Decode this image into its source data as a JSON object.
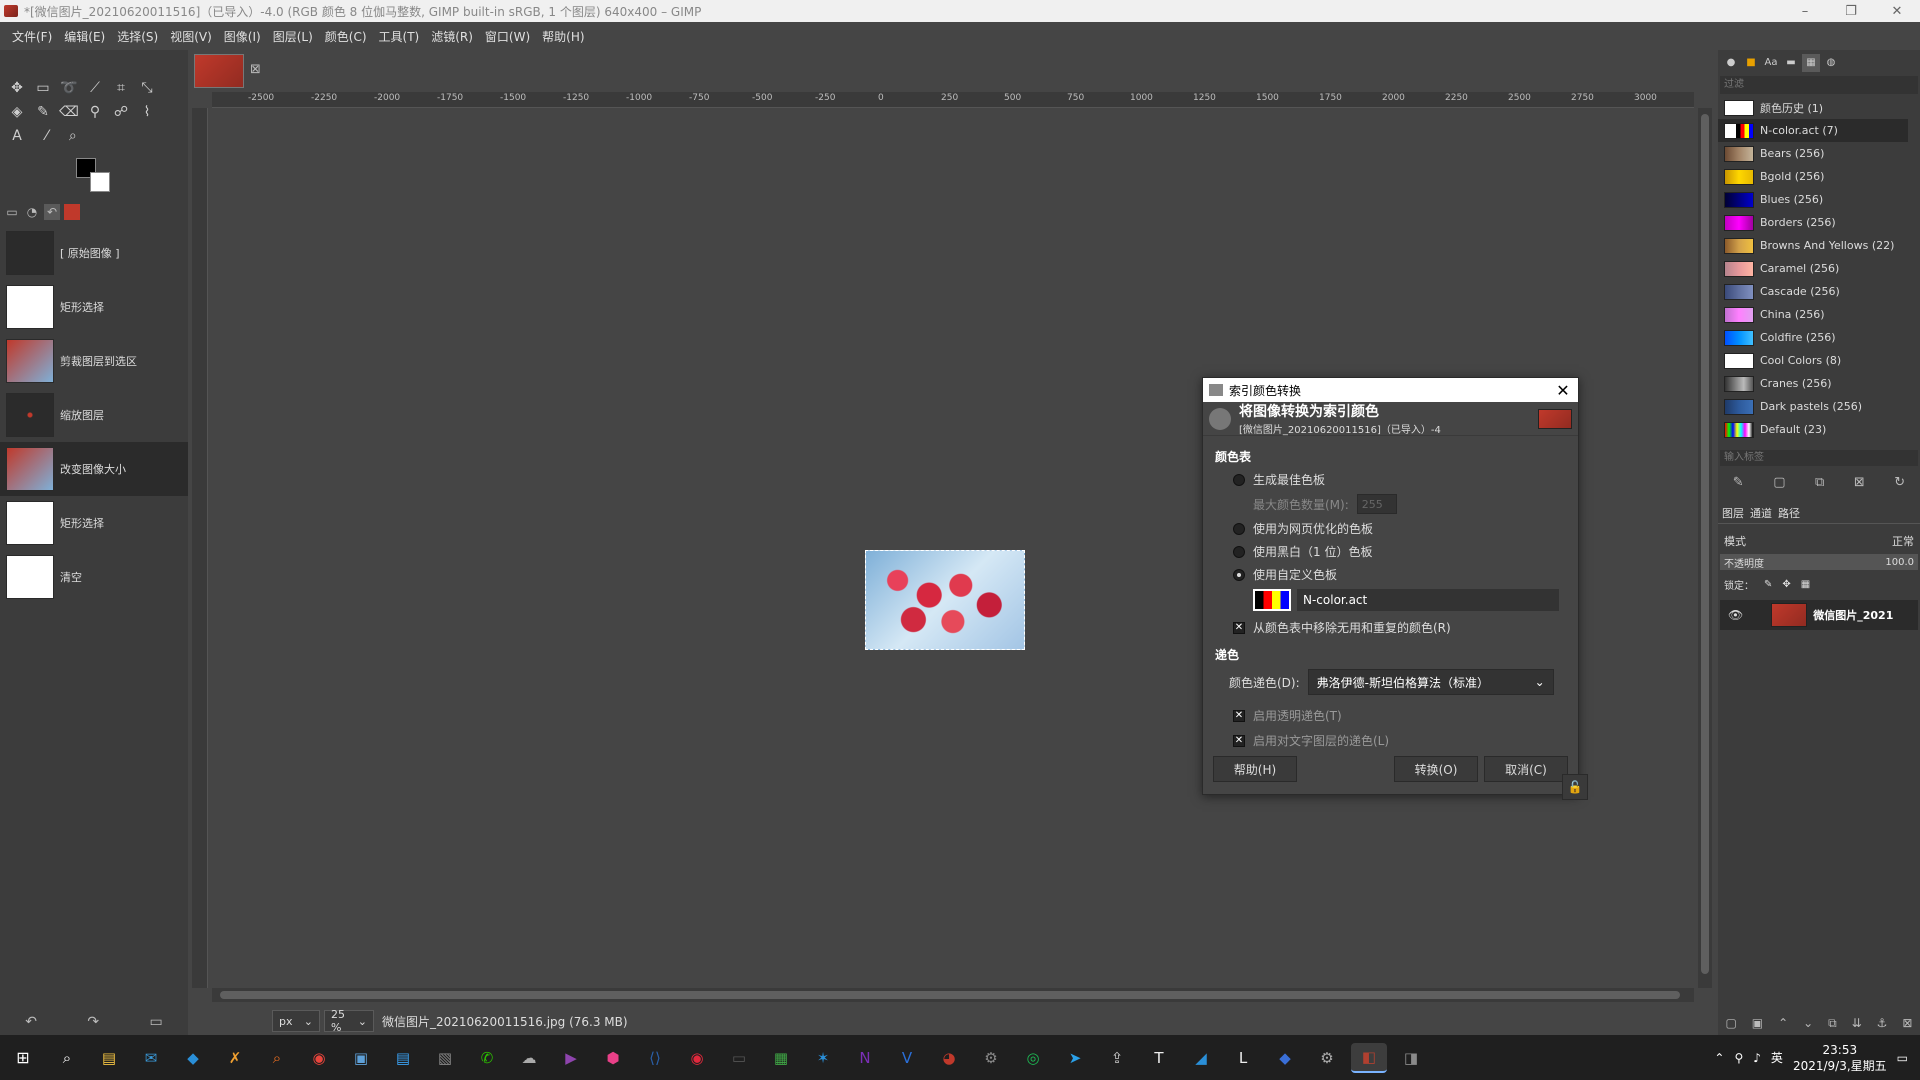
{
  "window": {
    "title": "*[微信图片_20210620011516]（已导入）-4.0 (RGB 颜色 8 位伽马整数, GIMP built-in sRGB, 1 个图层) 640x400 – GIMP",
    "minimize": "–",
    "maximize": "❐",
    "close": "✕"
  },
  "menu": [
    "文件(F)",
    "编辑(E)",
    "选择(S)",
    "视图(V)",
    "图像(I)",
    "图层(L)",
    "颜色(C)",
    "工具(T)",
    "滤镜(R)",
    "窗口(W)",
    "帮助(H)"
  ],
  "undo_history": [
    {
      "label": "[ 原始图像 ]",
      "thumb": "#2b2b2b"
    },
    {
      "label": "矩形选择",
      "thumb": "#ffffff"
    },
    {
      "label": "剪裁图层到选区",
      "thumb": "#c0392b"
    },
    {
      "label": "缩放图层",
      "thumb": "#2b2b2b"
    },
    {
      "label": "改变图像大小",
      "thumb": "#c0392b"
    },
    {
      "label": "矩形选择",
      "thumb": "#ffffff"
    },
    {
      "label": "清空",
      "thumb": "#ffffff"
    }
  ],
  "ruler": {
    "h_ticks": [
      "-2500",
      "-2250",
      "-2000",
      "-1750",
      "-1500",
      "-1250",
      "-1000",
      "-750",
      "-500",
      "-250",
      "0",
      "250",
      "500",
      "750",
      "1000",
      "1250",
      "1500",
      "1750",
      "2000",
      "2250",
      "2500",
      "2750",
      "3000",
      "3250"
    ]
  },
  "status": {
    "unit": "px",
    "zoom": "25 %",
    "file": "微信图片_20210620011516.jpg (76.3 MB)"
  },
  "palettes": {
    "filter_placeholder": "过滤",
    "tag_placeholder": "输入标签",
    "items": [
      {
        "name": "颜色历史 (1)",
        "swatch": "#ffffff"
      },
      {
        "name": "N-color.act (7)",
        "swatch": "linear-gradient(90deg,#fff 0,#fff 40%,#000 40%,#000 55%,#f00 55%,#f00 70%,#ff0 70%,#ff0 85%,#00f 85%)"
      },
      {
        "name": "Bears (256)",
        "swatch": "linear-gradient(90deg,#6b4a33,#a38467,#c4b49a)"
      },
      {
        "name": "Bgold (256)",
        "swatch": "linear-gradient(90deg,#c89500,#ffd700,#e6b800)"
      },
      {
        "name": "Blues (256)",
        "swatch": "linear-gradient(90deg,#000033,#000080,#0000cc)"
      },
      {
        "name": "Borders (256)",
        "swatch": "linear-gradient(90deg,#c000c0,#ff00ff,#a000a0)"
      },
      {
        "name": "Browns And Yellows (22)",
        "swatch": "linear-gradient(90deg,#8b5a2b,#d2a14a,#f0c040)"
      },
      {
        "name": "Caramel (256)",
        "swatch": "linear-gradient(90deg,#b5838d,#e5989b,#ffb4a2)"
      },
      {
        "name": "Cascade (256)",
        "swatch": "linear-gradient(90deg,#3a4a7a,#6070a0,#8090c0)"
      },
      {
        "name": "China (256)",
        "swatch": "linear-gradient(90deg,#c070d0,#ff80ff,#e0a0f0)"
      },
      {
        "name": "Coldfire (256)",
        "swatch": "linear-gradient(90deg,#0050ff,#0090ff,#40c0ff)"
      },
      {
        "name": "Cool Colors (8)",
        "swatch": "#ffffff"
      },
      {
        "name": "Cranes (256)",
        "swatch": "linear-gradient(90deg,#333,#777,#bbb,#555)"
      },
      {
        "name": "Dark pastels (256)",
        "swatch": "linear-gradient(90deg,#1f3a68,#2d5a9c,#3b6fb5)"
      },
      {
        "name": "Default (23)",
        "swatch": "linear-gradient(90deg,#f00,#0f0,#00f,#ff0,#0ff,#f0f,#fff,#000)"
      }
    ]
  },
  "layers": {
    "tabs": [
      "图层",
      "通道",
      "路径"
    ],
    "mode_label": "模式",
    "mode_value": "正常",
    "opacity_label": "不透明度",
    "opacity_value": "100.0",
    "lock_label": "锁定：",
    "layer_name": "微信图片_2021"
  },
  "dialog": {
    "title": "索引颜色转换",
    "heading": "将图像转换为索引颜色",
    "subheading": "[微信图片_20210620011516]（已导入）-4",
    "section_colormap": "颜色表",
    "opt_optimal": "生成最佳色板",
    "max_colors_label": "最大颜色数量(M):",
    "max_colors_value": "255",
    "opt_web": "使用为网页优化的色板",
    "opt_bw": "使用黑白（1 位）色板",
    "opt_custom": "使用自定义色板",
    "custom_palette": "N-color.act",
    "remove_unused": "从颜色表中移除无用和重复的颜色(R)",
    "section_dither": "递色",
    "dither_label": "颜色递色(D):",
    "dither_value": "弗洛伊德-斯坦伯格算法（标准）",
    "dither_transparency": "启用透明递色(T)",
    "dither_text": "启用对文字图层的递色(L)",
    "btn_help": "帮助(H)",
    "btn_convert": "转换(O)",
    "btn_cancel": "取消(C)"
  },
  "taskbar": {
    "icons": [
      "search-icon",
      "file-explorer-icon",
      "mail-icon",
      "vscode-icon",
      "app-x-icon",
      "search-tool-icon",
      "chrome-icon",
      "photos-icon",
      "store-icon",
      "screenshot-icon",
      "wechat-icon",
      "app-icon",
      "visual-studio-icon",
      "app-pink-icon",
      "code-icon",
      "netease-icon",
      "terminal-icon",
      "notepad-icon",
      "star-app-icon",
      "onenote-icon",
      "vs-icon",
      "paint-icon",
      "settings-app-icon",
      "music-icon",
      "telegram-icon",
      "upload-icon",
      "typora-icon",
      "app-blue-icon",
      "text-app-icon",
      "vscode-blue-icon",
      "gear-icon",
      "gimp-icon",
      "gimp-2-icon"
    ],
    "ime": "英",
    "time": "23:53",
    "date": "2021/9/3,星期五"
  }
}
